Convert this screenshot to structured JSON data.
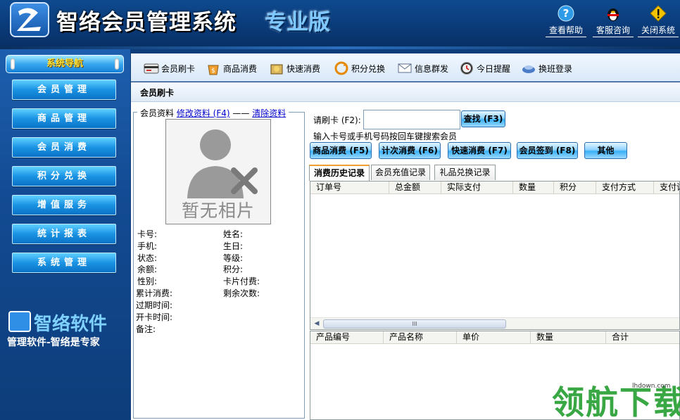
{
  "app": {
    "title": "智络会员管理系统",
    "edition": "专业版",
    "top_buttons": [
      {
        "label": "查看帮助",
        "icon": "help-icon"
      },
      {
        "label": "客服咨询",
        "icon": "qq-penguin-icon"
      },
      {
        "label": "关闭系统",
        "icon": "warning-icon"
      }
    ]
  },
  "sidebar": {
    "header": "系统导航",
    "items": [
      "会员管理",
      "商品管理",
      "会员消费",
      "积分兑换",
      "增值服务",
      "统计报表",
      "系统管理"
    ],
    "brand_name": "智络软件",
    "slogan": "管理软件-智络是专家"
  },
  "toolbar": {
    "items": [
      {
        "label": "会员刷卡",
        "icon": "card-icon"
      },
      {
        "label": "商品消费",
        "icon": "bag-icon"
      },
      {
        "label": "快速消费",
        "icon": "fast-consume-icon"
      },
      {
        "label": "积分兑换",
        "icon": "exchange-icon"
      },
      {
        "label": "信息群发",
        "icon": "envelope-icon"
      },
      {
        "label": "今日提醒",
        "icon": "clock-icon"
      },
      {
        "label": "换班登录",
        "icon": "shift-login-icon"
      }
    ]
  },
  "page": {
    "title": "会员刷卡",
    "member_info": {
      "legend": "会员资料",
      "edit_link": "修改资料 (F4)",
      "clear_link": "清除资料",
      "photo_text": "暂无相片",
      "fields_left": [
        "卡号:",
        "手机:",
        "状态:",
        "余额:",
        "性别:",
        "累计消费:",
        "过期时间:",
        "开卡时间:",
        "备注:"
      ],
      "fields_right": [
        "姓名:",
        "生日:",
        "等级:",
        "积分:",
        "卡片付费:",
        "剩余次数:"
      ]
    },
    "card": {
      "label": "请刷卡 (F2):",
      "value": "",
      "search_button": "查找 (F3)",
      "hint": "输入卡号或手机号码按回车键搜索会员"
    },
    "actions": [
      "商品消费 (F5)",
      "计次消费 (F6)",
      "快速消费 (F7)",
      "会员签到 (F8)",
      "其他"
    ],
    "tabs": [
      "消费历史记录",
      "会员充值记录",
      "礼品兑换记录"
    ],
    "history_columns": [
      "订单号",
      "总金额",
      "实际支付",
      "数量",
      "积分",
      "支付方式",
      "支付详"
    ],
    "detail_columns": [
      "产品编号",
      "产品名称",
      "单价",
      "数量",
      "合计"
    ],
    "scroll_thumb": "III"
  },
  "watermark": {
    "text": "领航下载",
    "url": "lhdown.com"
  }
}
